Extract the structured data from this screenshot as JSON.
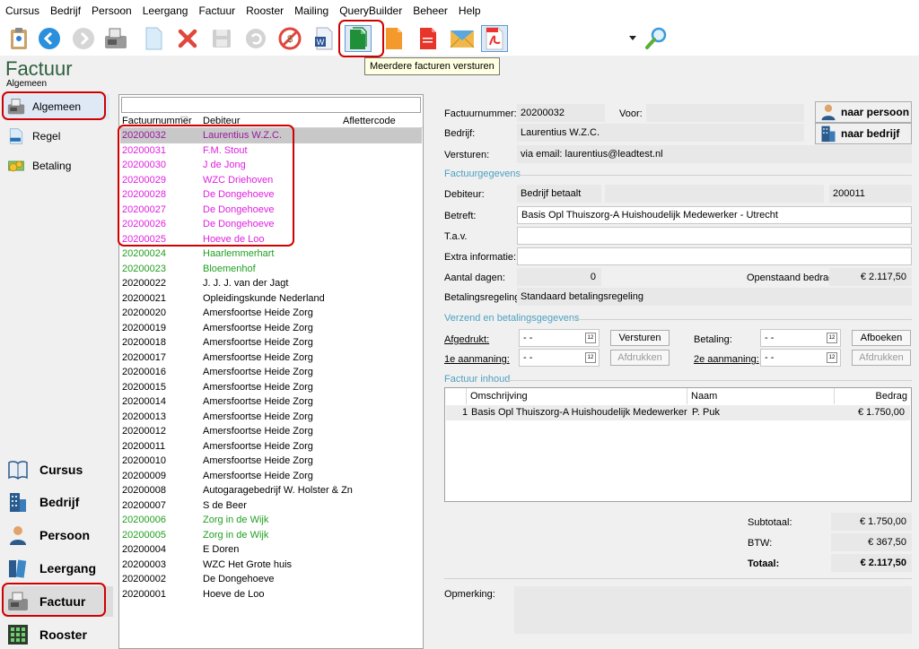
{
  "menu": [
    "Cursus",
    "Bedrijf",
    "Persoon",
    "Leergang",
    "Factuur",
    "Rooster",
    "Mailing",
    "QueryBuilder",
    "Beheer",
    "Help"
  ],
  "toolbar": {
    "tooltip": "Meerdere facturen versturen",
    "icons": [
      "clipboard-icon",
      "back-icon",
      "forward-icon",
      "fax-icon",
      "new-document-icon",
      "delete-icon",
      "save-icon",
      "undo-icon",
      "cancel-icon",
      "word-icon",
      "send-multiple-invoices-icon",
      "orange-document-icon",
      "red-document-icon",
      "email-icon",
      "pdf-icon",
      "dropdown-arrow-icon",
      "search-icon"
    ]
  },
  "page": {
    "title": "Factuur",
    "subtitle": "Algemeen"
  },
  "nav": {
    "tabs": [
      {
        "label": "Algemeen",
        "icon": "fax-icon"
      },
      {
        "label": "Regel",
        "icon": "invoice-icon"
      },
      {
        "label": "Betaling",
        "icon": "money-icon"
      }
    ],
    "modules": [
      {
        "label": "Cursus",
        "icon": "book-icon"
      },
      {
        "label": "Bedrijf",
        "icon": "building-icon"
      },
      {
        "label": "Persoon",
        "icon": "person-icon"
      },
      {
        "label": "Leergang",
        "icon": "books-icon"
      },
      {
        "label": "Factuur",
        "icon": "fax-icon"
      },
      {
        "label": "Rooster",
        "icon": "grid-icon"
      }
    ]
  },
  "list": {
    "filter_value": "",
    "headers": {
      "number": "Factuurnummer",
      "debtor": "Debiteur",
      "code": "Aflettercode"
    },
    "rows": [
      {
        "number": "20200032",
        "debtor": "Laurentius W.Z.C.",
        "color": "magenta"
      },
      {
        "number": "20200031",
        "debtor": "F.M. Stout",
        "color": "magenta"
      },
      {
        "number": "20200030",
        "debtor": "J de Jong",
        "color": "magenta"
      },
      {
        "number": "20200029",
        "debtor": "WZC Driehoven",
        "color": "magenta"
      },
      {
        "number": "20200028",
        "debtor": "De Dongehoeve",
        "color": "magenta"
      },
      {
        "number": "20200027",
        "debtor": "De Dongehoeve",
        "color": "magenta"
      },
      {
        "number": "20200026",
        "debtor": "De Dongehoeve",
        "color": "magenta"
      },
      {
        "number": "20200025",
        "debtor": "Hoeve de Loo",
        "color": "magenta"
      },
      {
        "number": "20200024",
        "debtor": "Haarlemmerhart",
        "color": "green"
      },
      {
        "number": "20200023",
        "debtor": "Bloemenhof",
        "color": "green"
      },
      {
        "number": "20200022",
        "debtor": "J. J. J. van der Jagt",
        "color": "black"
      },
      {
        "number": "20200021",
        "debtor": "Opleidingskunde Nederland",
        "color": "black"
      },
      {
        "number": "20200020",
        "debtor": "Amersfoortse Heide Zorg",
        "color": "black"
      },
      {
        "number": "20200019",
        "debtor": "Amersfoortse Heide Zorg",
        "color": "black"
      },
      {
        "number": "20200018",
        "debtor": "Amersfoortse Heide Zorg",
        "color": "black"
      },
      {
        "number": "20200017",
        "debtor": "Amersfoortse Heide Zorg",
        "color": "black"
      },
      {
        "number": "20200016",
        "debtor": "Amersfoortse Heide Zorg",
        "color": "black"
      },
      {
        "number": "20200015",
        "debtor": "Amersfoortse Heide Zorg",
        "color": "black"
      },
      {
        "number": "20200014",
        "debtor": "Amersfoortse Heide Zorg",
        "color": "black"
      },
      {
        "number": "20200013",
        "debtor": "Amersfoortse Heide Zorg",
        "color": "black"
      },
      {
        "number": "20200012",
        "debtor": "Amersfoortse Heide Zorg",
        "color": "black"
      },
      {
        "number": "20200011",
        "debtor": "Amersfoortse Heide Zorg",
        "color": "black"
      },
      {
        "number": "20200010",
        "debtor": "Amersfoortse Heide Zorg",
        "color": "black"
      },
      {
        "number": "20200009",
        "debtor": "Amersfoortse Heide Zorg",
        "color": "black"
      },
      {
        "number": "20200008",
        "debtor": "Autogaragebedrijf W. Holster & Zn",
        "color": "black"
      },
      {
        "number": "20200007",
        "debtor": "S de Beer",
        "color": "black"
      },
      {
        "number": "20200006",
        "debtor": "Zorg in de Wijk",
        "color": "green"
      },
      {
        "number": "20200005",
        "debtor": "Zorg in de Wijk",
        "color": "green"
      },
      {
        "number": "20200004",
        "debtor": "E Doren",
        "color": "black"
      },
      {
        "number": "20200003",
        "debtor": "WZC Het Grote huis",
        "color": "black"
      },
      {
        "number": "20200002",
        "debtor": "De Dongehoeve",
        "color": "black"
      },
      {
        "number": "20200001",
        "debtor": "Hoeve de Loo",
        "color": "black"
      }
    ],
    "selected_index": 0
  },
  "detail": {
    "invoice_number_label": "Factuurnummer:",
    "invoice_number": "20200032",
    "for_label": "Voor:",
    "for_value": "",
    "company_label": "Bedrijf:",
    "company": "Laurentius W.Z.C.",
    "send_label": "Versturen:",
    "send_value": "via email: laurentius@leadtest.nl",
    "btn_person": "naar persoon",
    "btn_company": "naar bedrijf",
    "section_invoice": "Factuurgegevens",
    "debtor_label": "Debiteur:",
    "debtor_value": "Bedrijf betaalt",
    "debtor_extra": "",
    "debtor_code": "200011",
    "subject_label": "Betreft:",
    "subject": "Basis Opl Thuiszorg-A Huishoudelijk Medewerker - Utrecht",
    "attn_label": "T.a.v.",
    "attn": "",
    "extra_label": "Extra informatie:",
    "extra": "",
    "days_label": "Aantal dagen:",
    "days": "0",
    "open_label": "Openstaand bedrag:",
    "open_amount": "€ 2.117,50",
    "payment_plan_label": "Betalingsregeling:",
    "payment_plan": "Standaard betalingsregeling",
    "section_send": "Verzend en betalingsgegevens",
    "printed_label": "Afgedrukt:",
    "printed_date": "-  -",
    "btn_send": "Versturen",
    "payment_label": "Betaling:",
    "payment_date": "-  -",
    "btn_book": "Afboeken",
    "reminder1_label": "1e aanmaning:",
    "reminder1_date": "-  -",
    "btn_print1": "Afdrukken",
    "reminder2_label": "2e aanmaning:",
    "reminder2_date": "-  -",
    "btn_print2": "Afdrukken",
    "section_content": "Factuur inhoud",
    "content_headers": {
      "desc": "Omschrijving",
      "name": "Naam",
      "amount": "Bedrag"
    },
    "content_rows": [
      {
        "qty": "1",
        "desc": "Basis Opl Thuiszorg-A Huishoudelijk Medewerker",
        "name": "P. Puk",
        "amount": "€ 1.750,00"
      }
    ],
    "subtotal_label": "Subtotaal:",
    "subtotal": "€ 1.750,00",
    "vat_label": "BTW:",
    "vat": "€ 367,50",
    "total_label": "Totaal:",
    "total": "€ 2.117,50",
    "remark_label": "Opmerking:",
    "remark": ""
  },
  "colors": {
    "title_green": "#2e5f3d",
    "section_blue": "#4da1c2",
    "row_magenta": "#e020e0",
    "row_green": "#20a020",
    "highlight_red": "#d00000"
  }
}
